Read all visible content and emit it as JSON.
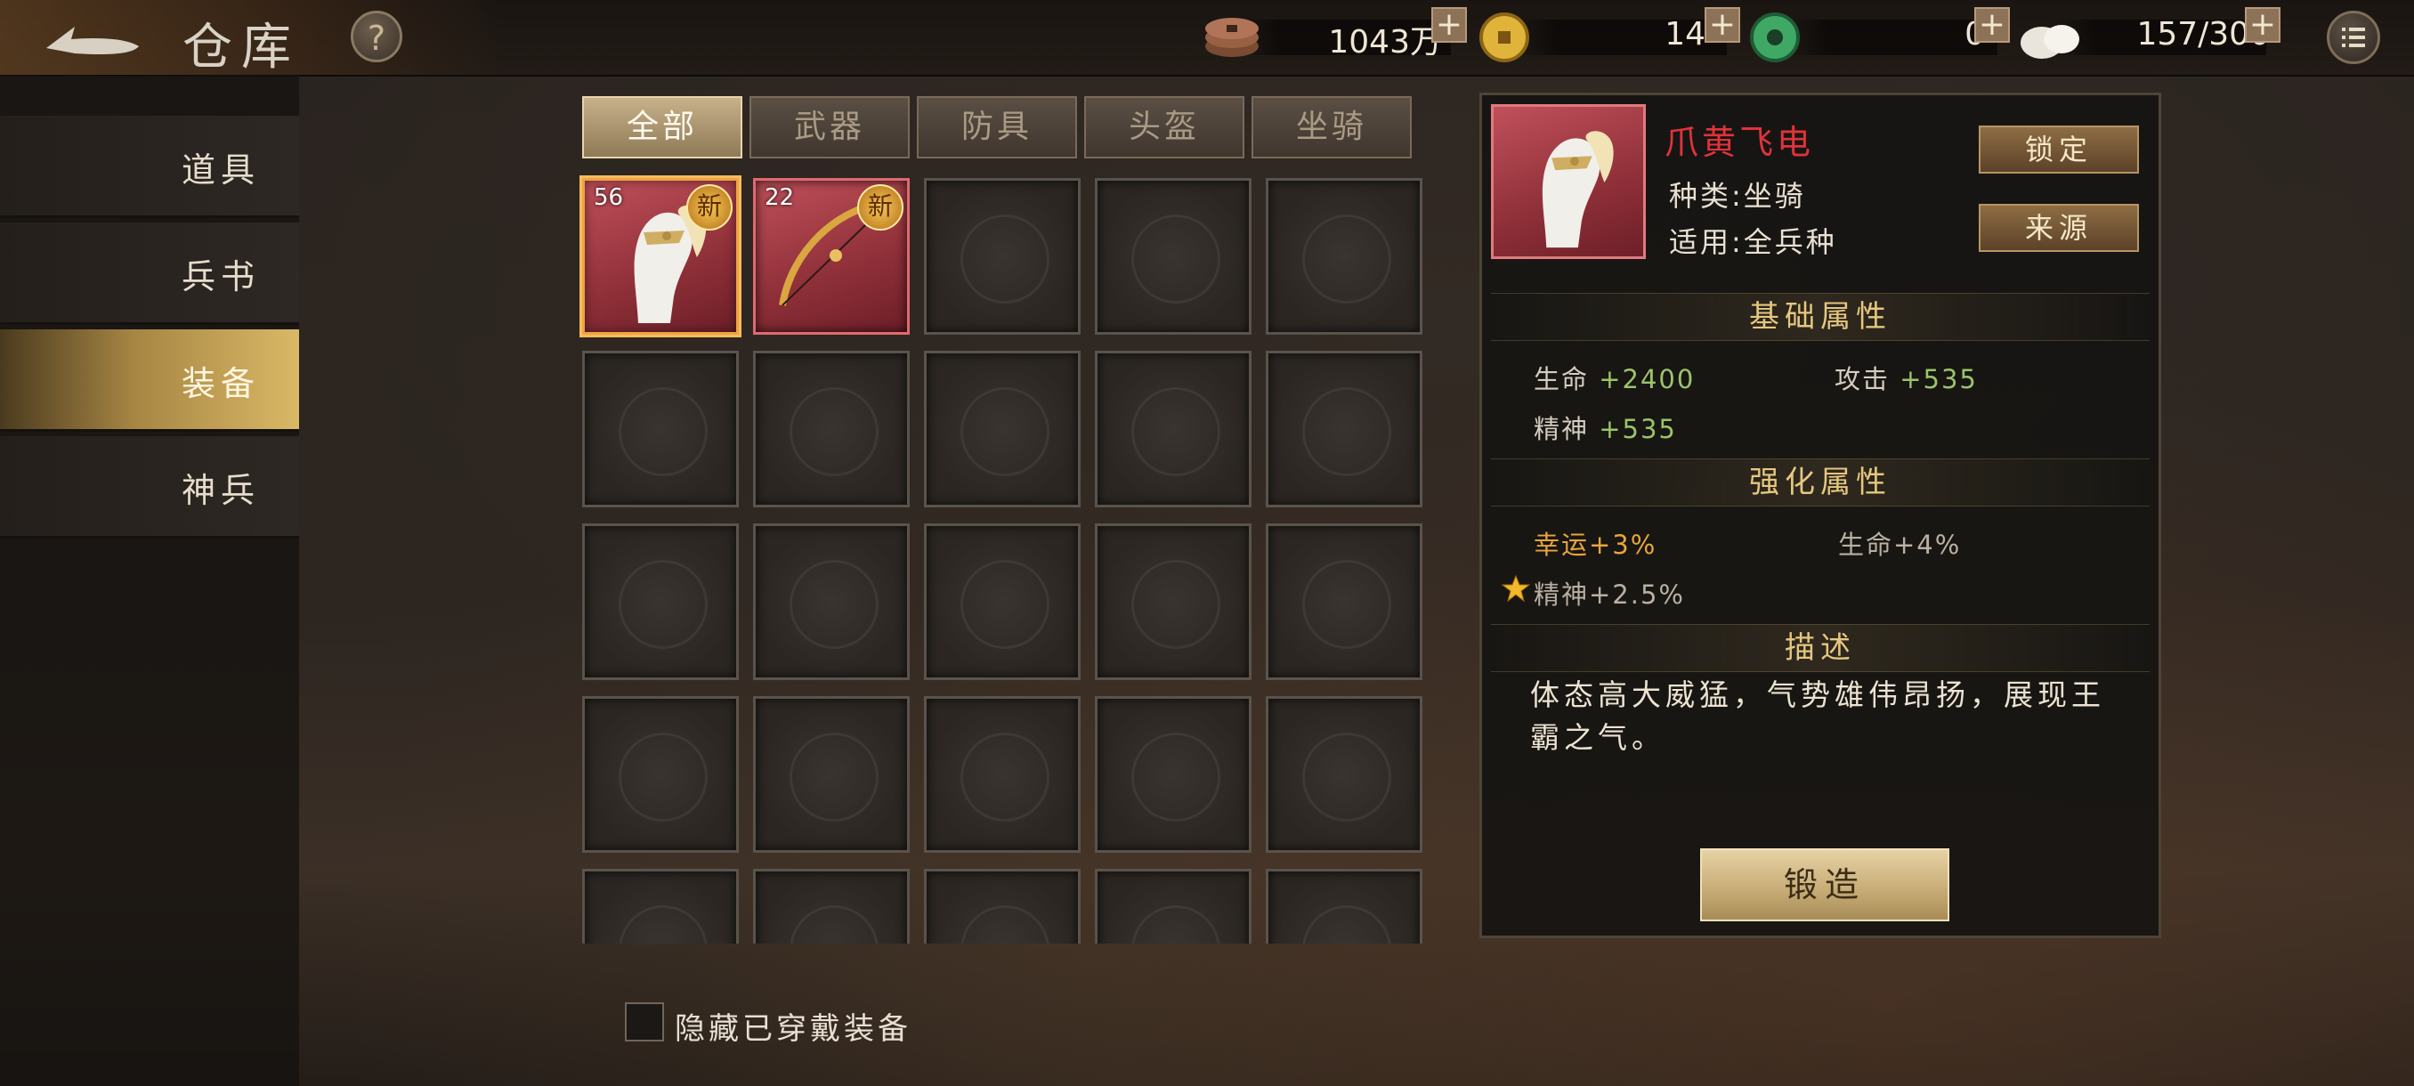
{
  "header": {
    "title": "仓库",
    "help_label": "?",
    "resources": [
      {
        "name": "copper",
        "icon": "copper-coins-icon",
        "value": "1043万"
      },
      {
        "name": "gold",
        "icon": "gold-coin-icon",
        "value": "14"
      },
      {
        "name": "jade",
        "icon": "jade-icon",
        "value": "0"
      },
      {
        "name": "buns",
        "icon": "bun-icon",
        "value": "157/300"
      }
    ],
    "plus_label": "+"
  },
  "sidebar": {
    "items": [
      {
        "label": "道具",
        "active": false
      },
      {
        "label": "兵书",
        "active": false
      },
      {
        "label": "装备",
        "active": true
      },
      {
        "label": "神兵",
        "active": false
      }
    ]
  },
  "tabs": [
    {
      "label": "全部",
      "active": true
    },
    {
      "label": "武器",
      "active": false
    },
    {
      "label": "防具",
      "active": false
    },
    {
      "label": "头盔",
      "active": false
    },
    {
      "label": "坐骑",
      "active": false
    }
  ],
  "inventory": {
    "items": [
      {
        "level": "56",
        "new_label": "新",
        "icon": "horse-mount-icon",
        "selected": true
      },
      {
        "level": "22",
        "new_label": "新",
        "icon": "bow-icon",
        "selected": false
      }
    ],
    "hide_equipped_label": "隐藏已穿戴装备"
  },
  "detail": {
    "name": "爪黄飞电",
    "type_label": "种类",
    "type_value": "坐骑",
    "applies_label": "适用",
    "applies_value": "全兵种",
    "lock_label": "锁定",
    "source_label": "来源",
    "base_title": "基础属性",
    "base_stats": [
      {
        "label": "生命",
        "value": "+2400"
      },
      {
        "label": "攻击",
        "value": "+535"
      },
      {
        "label": "精神",
        "value": "+535"
      }
    ],
    "enhance_title": "强化属性",
    "enhance_stats": [
      "幸运+3%",
      "生命+4%",
      "精神+2.5%"
    ],
    "desc_title": "描述",
    "description": "体态高大威猛，气势雄伟昂扬，展现王霸之气。",
    "forge_label": "锻造"
  },
  "colors": {
    "item_name": "#e0333a",
    "stat_value": "#9cc46a",
    "luck": "#e7a53b",
    "active_nav": "#d9b866"
  }
}
